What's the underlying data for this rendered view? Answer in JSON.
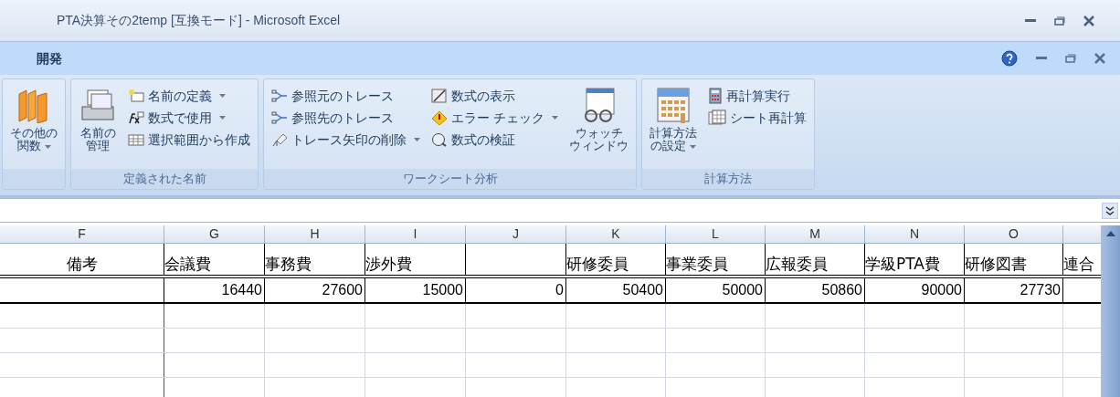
{
  "window": {
    "title": "PTA決算その2temp [互換モード] - Microsoft Excel"
  },
  "tabs": [
    {
      "label": "開発"
    }
  ],
  "ribbon_groups": [
    {
      "items": [
        {
          "kind": "large",
          "lines": [
            "その他の",
            "関数"
          ],
          "dropdown": true
        }
      ]
    },
    {
      "label": "定義された名前",
      "items": [
        {
          "kind": "large",
          "lines": [
            "名前の",
            "管理"
          ],
          "dropdown": false
        },
        {
          "kind": "column",
          "items": [
            {
              "label": "名前の定義",
              "dropdown": true
            },
            {
              "label": "数式で使用",
              "dropdown": true
            },
            {
              "label": "選択範囲から作成",
              "dropdown": false
            }
          ]
        }
      ]
    },
    {
      "label": "ワークシート分析",
      "items": [
        {
          "kind": "column",
          "items": [
            {
              "label": "参照元のトレース",
              "dropdown": false
            },
            {
              "label": "参照先のトレース",
              "dropdown": false
            },
            {
              "label": "トレース矢印の削除",
              "dropdown": true
            }
          ]
        },
        {
          "kind": "column",
          "items": [
            {
              "label": "数式の表示",
              "dropdown": false
            },
            {
              "label": "エラー チェック",
              "dropdown": true
            },
            {
              "label": "数式の検証",
              "dropdown": false
            }
          ]
        },
        {
          "kind": "large",
          "lines": [
            "ウォッチ",
            "ウィンドウ"
          ],
          "dropdown": false
        }
      ]
    },
    {
      "label": "計算方法",
      "items": [
        {
          "kind": "large",
          "lines": [
            "計算方法",
            "の設定"
          ],
          "dropdown": true
        },
        {
          "kind": "column",
          "items": [
            {
              "label": "再計算実行",
              "dropdown": false
            },
            {
              "label": "シート再計算",
              "dropdown": false
            }
          ]
        }
      ]
    }
  ],
  "columns": [
    {
      "letter": "F",
      "header": "備考"
    },
    {
      "letter": "G",
      "header": "会議費",
      "value": "16440"
    },
    {
      "letter": "H",
      "header": "事務費",
      "value": "27600"
    },
    {
      "letter": "I",
      "header": "渉外費",
      "value": "15000"
    },
    {
      "letter": "J",
      "value": "0"
    },
    {
      "letter": "K",
      "header": "研修委員",
      "value": "50400"
    },
    {
      "letter": "L",
      "header": "事業委員",
      "value": "50000"
    },
    {
      "letter": "M",
      "header": "広報委員",
      "value": "50860"
    },
    {
      "letter": "N",
      "header": "学級PTA費",
      "value": "90000"
    },
    {
      "letter": "O",
      "header": "研修図書",
      "value": "27730"
    },
    {
      "header": "連合"
    }
  ]
}
